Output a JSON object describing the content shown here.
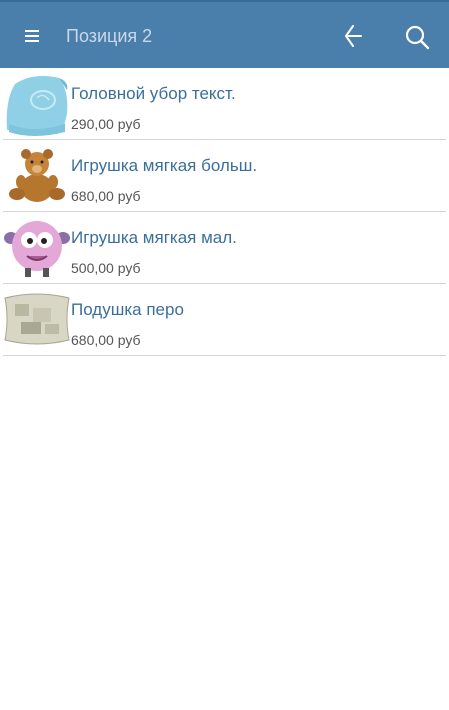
{
  "header": {
    "title": "Позиция 2",
    "menu_icon": "hamburger-menu-icon",
    "back_icon": "back-arrow-icon",
    "search_icon": "search-icon",
    "background_color": "#4a7eab",
    "icon_color": "#ffffff"
  },
  "products": [
    {
      "name": "Головной убор текст.",
      "price": "290,00 руб",
      "image": "blue-knit-hat"
    },
    {
      "name": "Игрушка мягкая больш.",
      "price": "680,00 руб",
      "image": "teddy-bear"
    },
    {
      "name": "Игрушка мягкая мал.",
      "price": "500,00 руб",
      "image": "pink-sheep-toy"
    },
    {
      "name": "Подушка перо",
      "price": "680,00 руб",
      "image": "feather-pillow"
    }
  ]
}
